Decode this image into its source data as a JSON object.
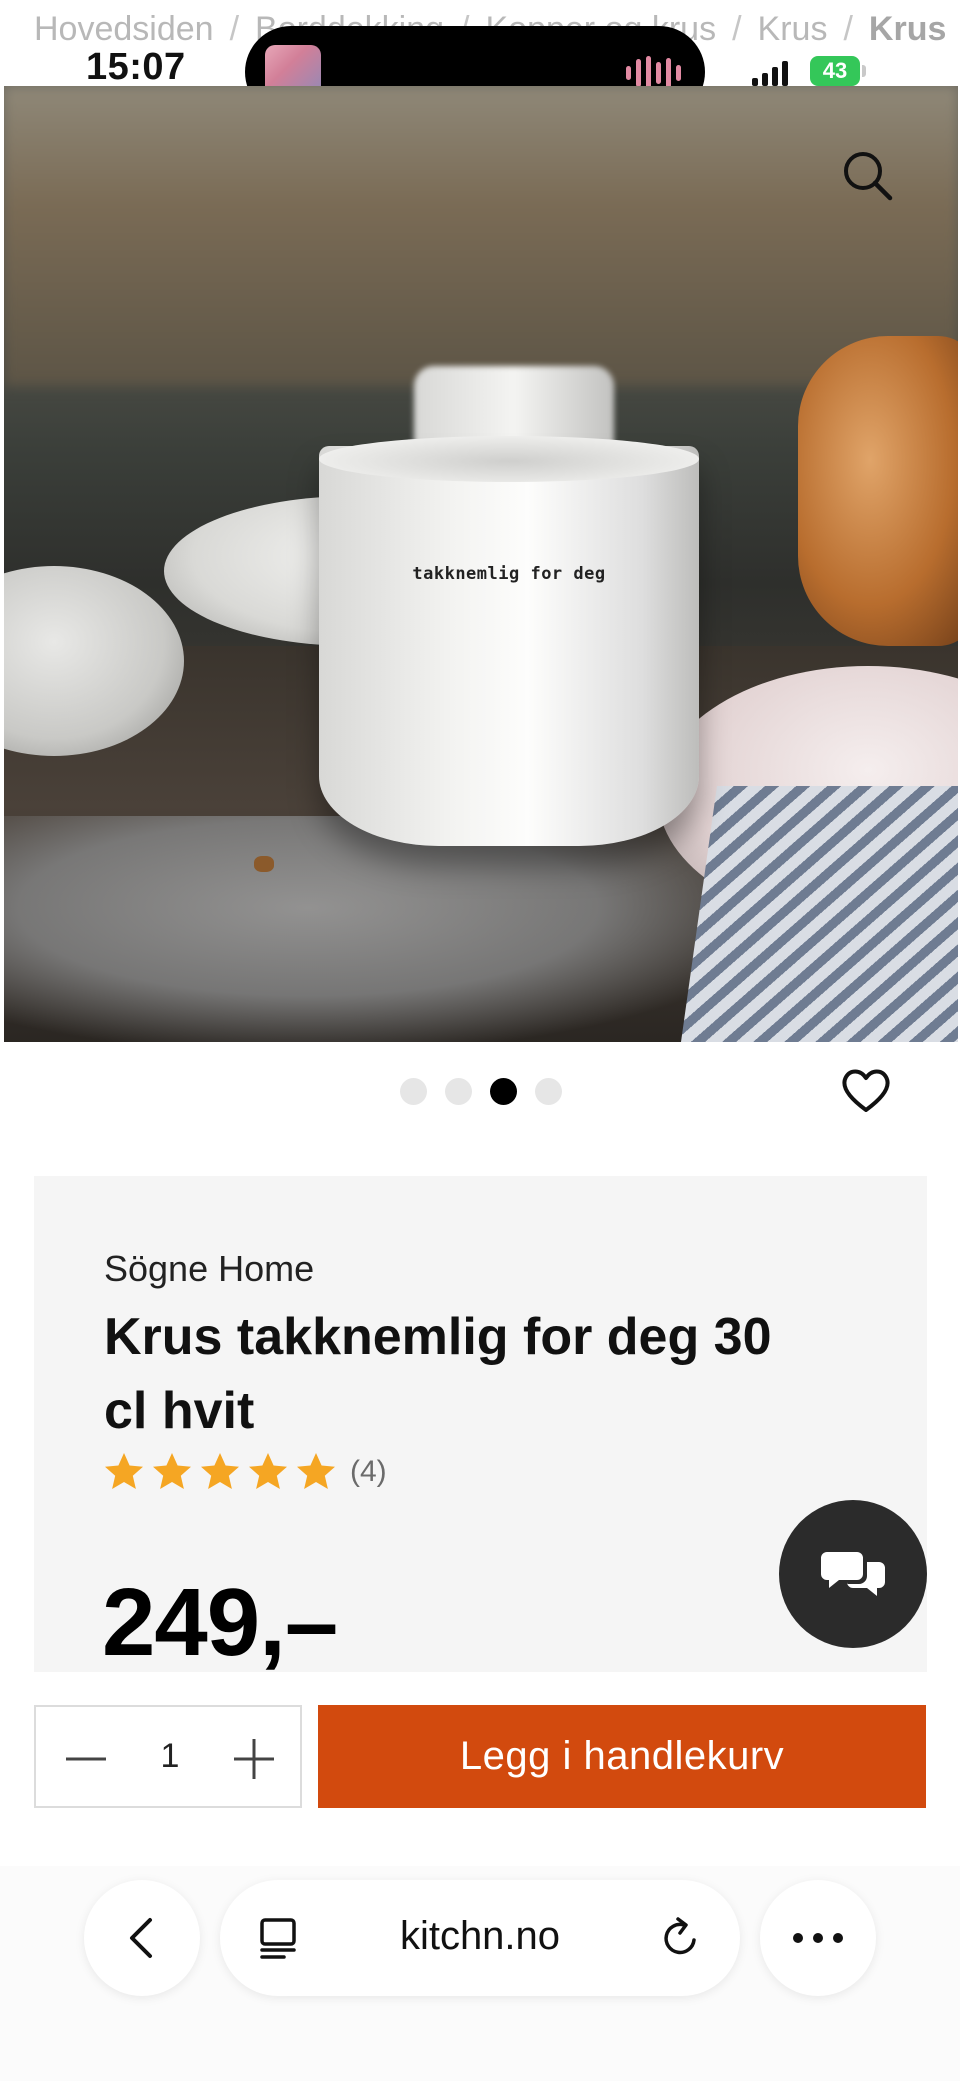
{
  "breadcrumb": {
    "items": [
      "Hovedsiden",
      "Borddekking",
      "Kopper og krus",
      "Krus"
    ],
    "current": "Krus"
  },
  "status_bar": {
    "time": "15:07",
    "battery": "43"
  },
  "product_image": {
    "mug_text": "takknemlig for deg",
    "carousel_count": 4,
    "carousel_active_index": 2
  },
  "product": {
    "brand": "Sögne Home",
    "title": "Krus takknemlig for deg 30 cl hvit",
    "rating_stars": 5,
    "rating_count": "(4)",
    "price": "249,–"
  },
  "purchase": {
    "quantity": "1",
    "add_to_cart_label": "Legg i handlekurv"
  },
  "browser": {
    "address": "kitchn.no"
  },
  "colors": {
    "accent": "#d24a0e",
    "star": "#f5a623",
    "chat_button": "#2b2b2b",
    "battery": "#34c759"
  },
  "icons": [
    "search-icon",
    "heart-icon",
    "star-icon",
    "chat-icon",
    "minus-icon",
    "plus-icon",
    "chevron-left-icon",
    "reader-icon",
    "reload-icon",
    "more-icon"
  ]
}
